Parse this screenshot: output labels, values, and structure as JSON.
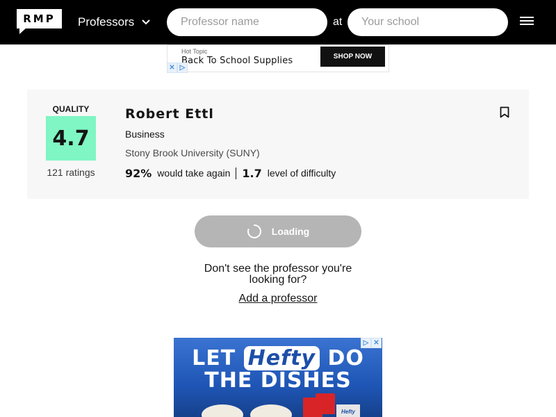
{
  "header": {
    "logo_text": "RMP",
    "search_type": "Professors",
    "professor_placeholder": "Professor name",
    "at_label": "at",
    "school_placeholder": "Your school"
  },
  "ad_top": {
    "brand": "Hot Topic",
    "headline": "Back To School Supplies",
    "cta": "SHOP NOW"
  },
  "professor": {
    "quality_label": "QUALITY",
    "quality_score": "4.7",
    "ratings_count": "121 ratings",
    "name": "Robert Ettl",
    "department": "Business",
    "school": "Stony Brook University (SUNY)",
    "would_take_again": "92%",
    "would_take_again_label": "would take again",
    "difficulty": "1.7",
    "difficulty_label": "level of difficulty"
  },
  "load_button": {
    "label": "Loading"
  },
  "not_found": {
    "line1": "Don't see the professor you're",
    "line2": "looking for?",
    "link": "Add a professor"
  },
  "ad_bottom": {
    "word1": "LET",
    "brand": "Hefty",
    "word2": "DO",
    "line2": "THE DISHES",
    "package_label": "Hefty"
  },
  "colors": {
    "header_bg": "#000000",
    "quality_high": "#7ff6c3",
    "card_bg": "#f7f7f7",
    "loading_bg": "#b5b5b5"
  }
}
